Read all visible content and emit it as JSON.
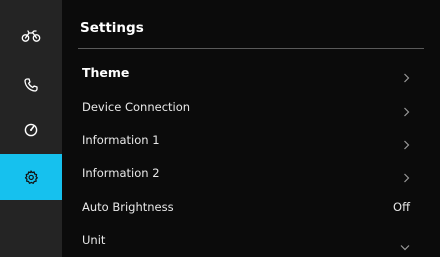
{
  "sidebar": {
    "items": [
      {
        "icon": "motorcycle-icon",
        "active": false
      },
      {
        "icon": "phone-icon",
        "active": false
      },
      {
        "icon": "speedometer-icon",
        "active": false
      },
      {
        "icon": "gear-icon",
        "active": true
      }
    ]
  },
  "header": {
    "title": "Settings"
  },
  "menu": {
    "items": [
      {
        "label": "Theme",
        "control": "chevron-right-icon"
      },
      {
        "label": "Device Connection",
        "control": "chevron-right-icon"
      },
      {
        "label": "Information 1",
        "control": "chevron-right-icon"
      },
      {
        "label": "Information 2",
        "control": "chevron-right-icon"
      },
      {
        "label": "Auto Brightness",
        "value": "Off"
      },
      {
        "label": "Unit",
        "control": "chevron-down-icon"
      }
    ]
  },
  "colors": {
    "accent": "#16c1ee",
    "sidebar_bg": "#242424",
    "main_bg": "#0b0b0b"
  }
}
